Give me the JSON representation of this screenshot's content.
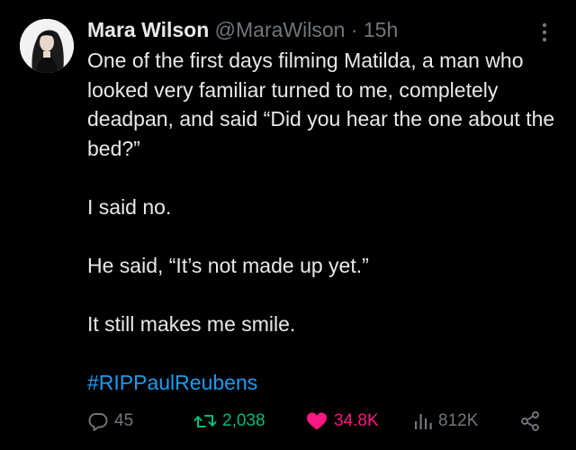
{
  "author": {
    "display_name": "Mara Wilson",
    "handle": "@MaraWilson",
    "separator": "·",
    "time": "15h"
  },
  "tweet": {
    "paragraphs": [
      "One of the first days filming Matilda, a man who looked very familiar turned to me, completely deadpan, and said “Did you hear the one about the bed?”",
      "I said no.",
      "He said, “It’s not made up yet.”",
      "It still makes me smile."
    ],
    "hashtag": "#RIPPaulReubens"
  },
  "actions": {
    "replies": "45",
    "reposts": "2,038",
    "likes": "34.8K",
    "views": "812K"
  },
  "icons": {
    "more": "more-vertical-icon",
    "reply": "reply-icon",
    "repost": "repost-icon",
    "like": "heart-icon",
    "views": "views-icon",
    "share": "share-icon"
  },
  "colors": {
    "background": "#000000",
    "text": "#e7e9ea",
    "muted": "#71767b",
    "link": "#1d9bf0",
    "repost_active": "#00ba7c",
    "like_active": "#f91880"
  }
}
